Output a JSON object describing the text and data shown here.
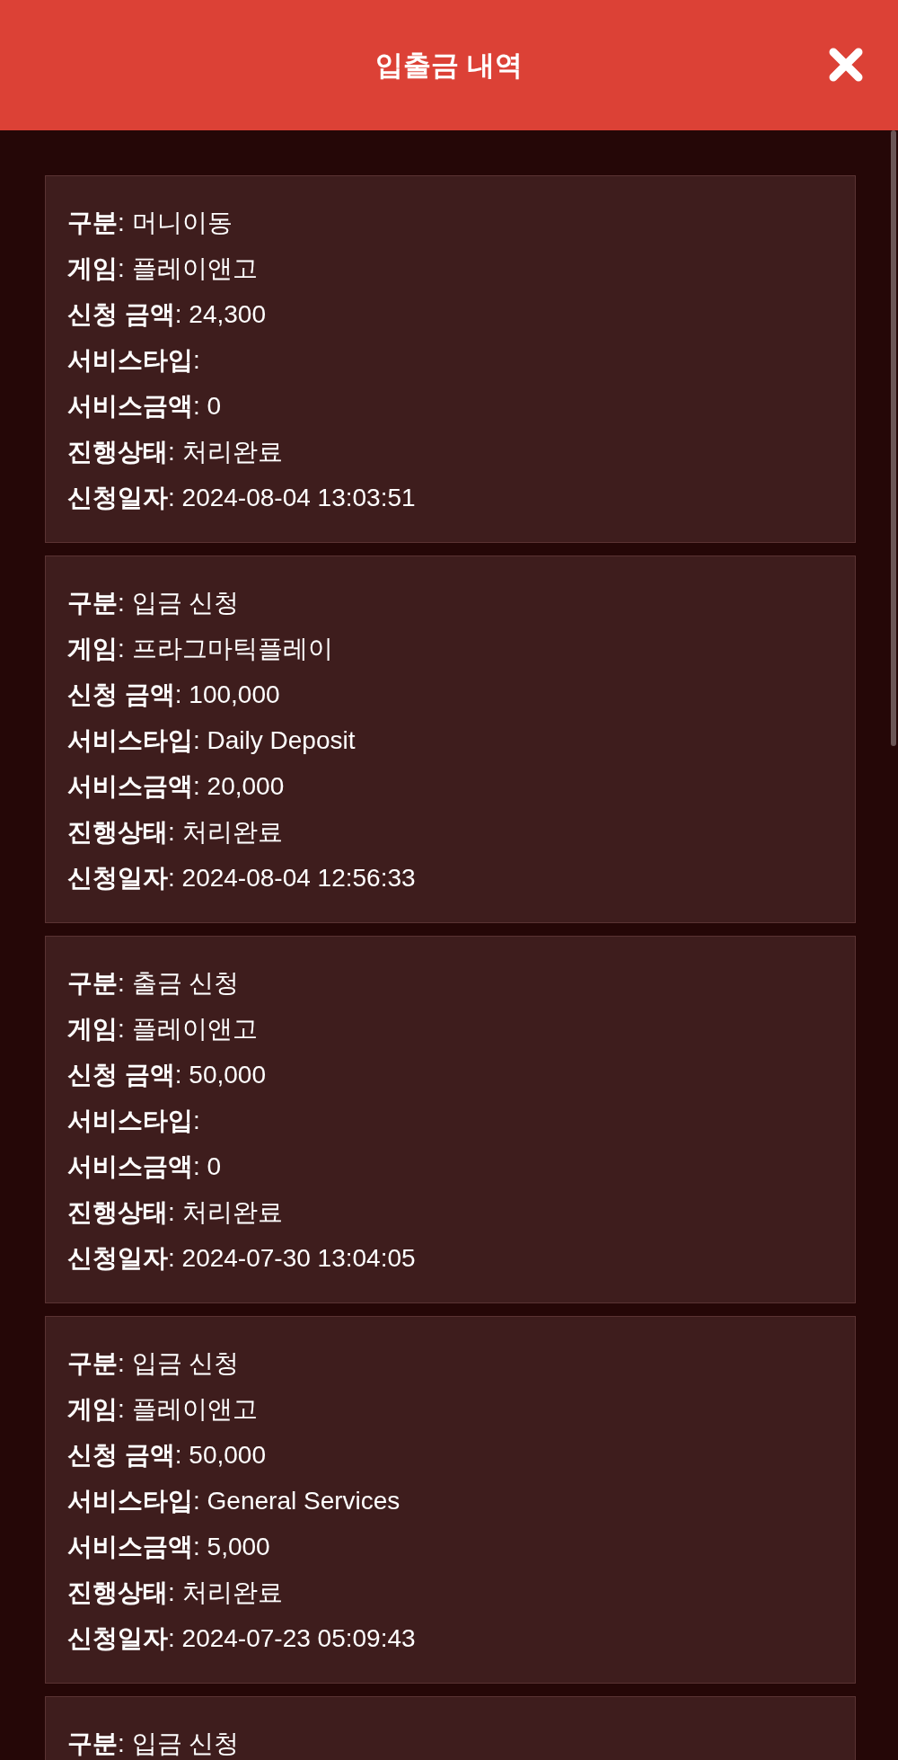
{
  "header": {
    "title": "입출금 내역"
  },
  "records": [
    {
      "lines": [
        "**구분**: 머니이동",
        "**게임**: 플레이앤고",
        "**신청 금액**: 24,300",
        "**서비스타입**:",
        "**서비스금액**: 0",
        "**진행상태**: 처리완료",
        "**신청일자**: 2024-08-04 13:03:51"
      ]
    },
    {
      "lines": [
        "**구분**: 입금 신청",
        "**게임**: 프라그마틱플레이",
        "**신청 금액**: 100,000",
        "**서비스타입**: Daily Deposit",
        "**서비스금액**: 20,000",
        "**진행상태**: 처리완료",
        "**신청일자**: 2024-08-04 12:56:33"
      ]
    },
    {
      "lines": [
        "**구분**: 출금 신청",
        "**게임**: 플레이앤고",
        "**신청 금액**: 50,000",
        "**서비스타입**:",
        "**서비스금액**: 0",
        "**진행상태**: 처리완료",
        "**신청일자**: 2024-07-30 13:04:05"
      ]
    },
    {
      "lines": [
        "**구분**: 입금 신청",
        "**게임**: 플레이앤고",
        "**신청 금액**: 50,000",
        "**서비스타입**: General Services",
        "**서비스금액**: 5,000",
        "**진행상태**: 처리완료",
        "**신청일자**: 2024-07-23 05:09:43"
      ]
    },
    {
      "lines": [
        "**구분**: 입금 신청"
      ]
    }
  ]
}
